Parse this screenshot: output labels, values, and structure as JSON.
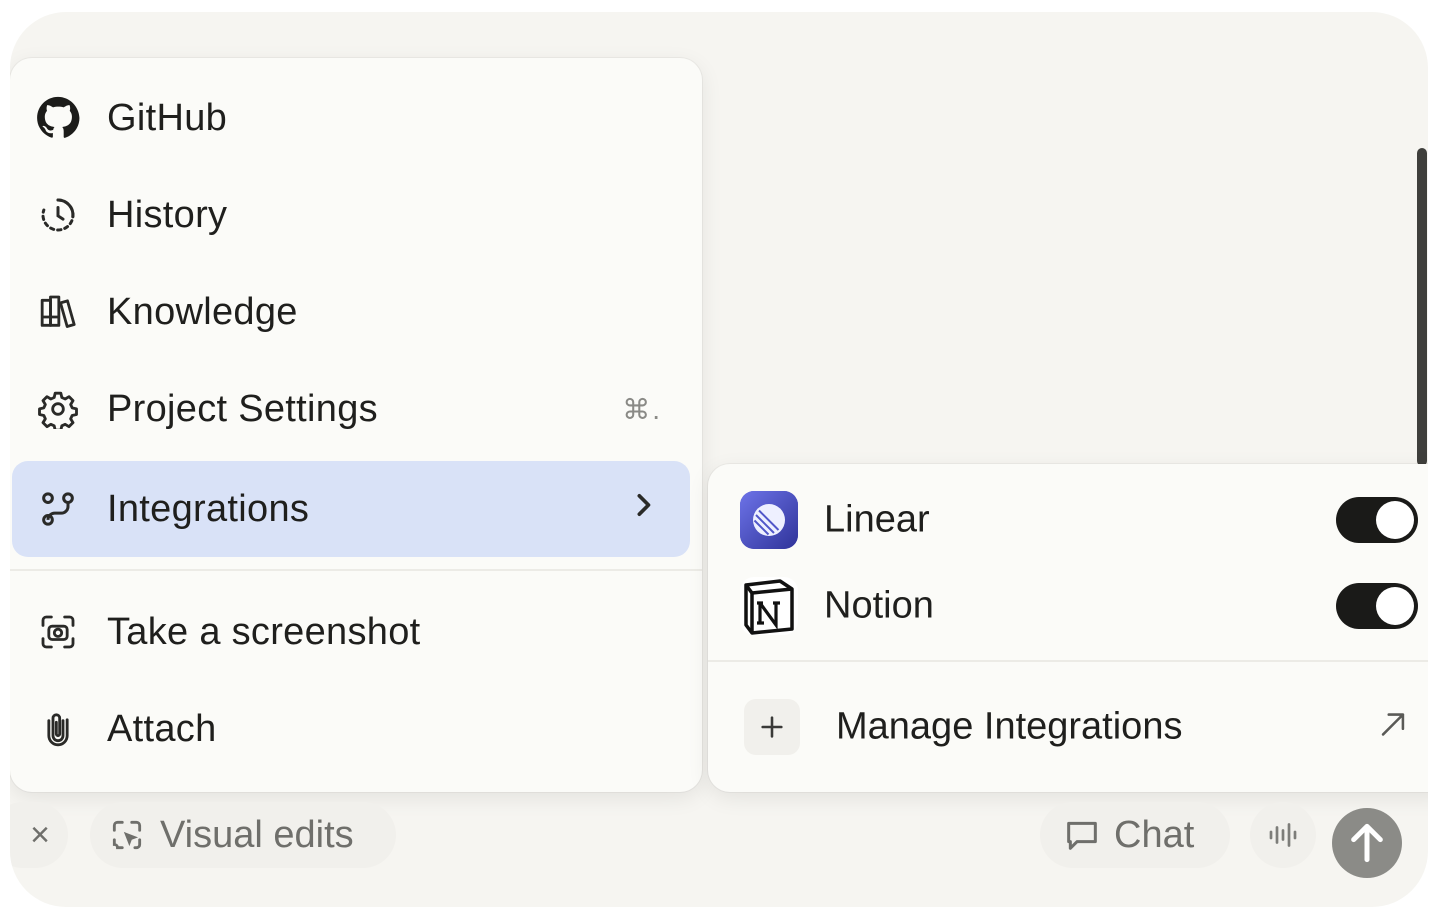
{
  "menu": {
    "items": [
      {
        "label": "GitHub",
        "icon": "github-icon"
      },
      {
        "label": "History",
        "icon": "history-icon"
      },
      {
        "label": "Knowledge",
        "icon": "books-icon"
      },
      {
        "label": "Project Settings",
        "icon": "gear-icon",
        "shortcut": "⌘."
      },
      {
        "label": "Integrations",
        "icon": "integrations-icon",
        "active": true
      },
      {
        "label": "Take a screenshot",
        "icon": "screenshot-icon"
      },
      {
        "label": "Attach",
        "icon": "paperclip-icon"
      }
    ]
  },
  "integrations": {
    "items": [
      {
        "label": "Linear",
        "icon": "linear-logo-icon",
        "enabled": true
      },
      {
        "label": "Notion",
        "icon": "notion-logo-icon",
        "enabled": true
      }
    ],
    "manage_label": "Manage Integrations"
  },
  "bottombar": {
    "close_label": "×",
    "visual_edits_label": "Visual edits",
    "chat_label": "Chat"
  },
  "colors": {
    "active_item_bg": "#d9e2f7",
    "toggle_on": "#1a1a18",
    "linear_brand": "#4a4fc4",
    "send_button": "#8b8b87"
  }
}
